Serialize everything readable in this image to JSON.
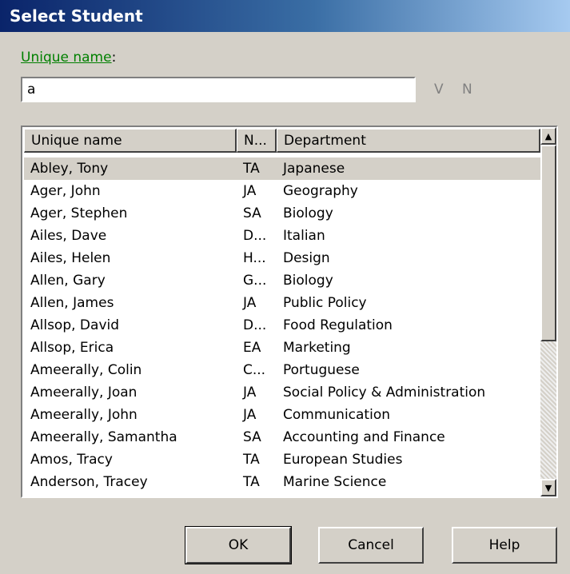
{
  "dialog": {
    "title": "Select Student"
  },
  "search": {
    "label_accel": "Unique name",
    "label_suffix": ":",
    "value": "a",
    "v_label": "V",
    "n_label": "N"
  },
  "list": {
    "columns": [
      "Unique name",
      "N...",
      "Department"
    ],
    "selected_index": 0,
    "scroll_position": 0.0,
    "rows": [
      {
        "name": "Abley, Tony",
        "n": "TA",
        "department": "Japanese"
      },
      {
        "name": "Ager, John",
        "n": "JA",
        "department": "Geography"
      },
      {
        "name": "Ager, Stephen",
        "n": "SA",
        "department": "Biology"
      },
      {
        "name": "Ailes, Dave",
        "n": "D...",
        "department": "Italian"
      },
      {
        "name": "Ailes, Helen",
        "n": "H...",
        "department": "Design"
      },
      {
        "name": "Allen, Gary",
        "n": "G...",
        "department": "Biology"
      },
      {
        "name": "Allen, James",
        "n": "JA",
        "department": "Public Policy"
      },
      {
        "name": "Allsop, David",
        "n": "D...",
        "department": "Food Regulation"
      },
      {
        "name": "Allsop, Erica",
        "n": "EA",
        "department": "Marketing"
      },
      {
        "name": "Ameerally, Colin",
        "n": "C...",
        "department": "Portuguese"
      },
      {
        "name": "Ameerally, Joan",
        "n": "JA",
        "department": "Social Policy & Administration"
      },
      {
        "name": "Ameerally, John",
        "n": "JA",
        "department": "Communication"
      },
      {
        "name": "Ameerally, Samantha",
        "n": "SA",
        "department": "Accounting and Finance"
      },
      {
        "name": "Amos, Tracy",
        "n": "TA",
        "department": "European Studies"
      },
      {
        "name": "Anderson, Tracey",
        "n": "TA",
        "department": "Marine Science"
      }
    ]
  },
  "buttons": {
    "ok": "OK",
    "cancel": "Cancel",
    "help": "Help"
  },
  "icons": {
    "scroll_up": "arrow-up-icon",
    "scroll_down": "arrow-down-icon"
  },
  "colors": {
    "title_gradient_start": "#0a246a",
    "title_gradient_end": "#a6caf0",
    "accelerator_label": "#008000",
    "dialog_face": "#d4d0c8"
  }
}
